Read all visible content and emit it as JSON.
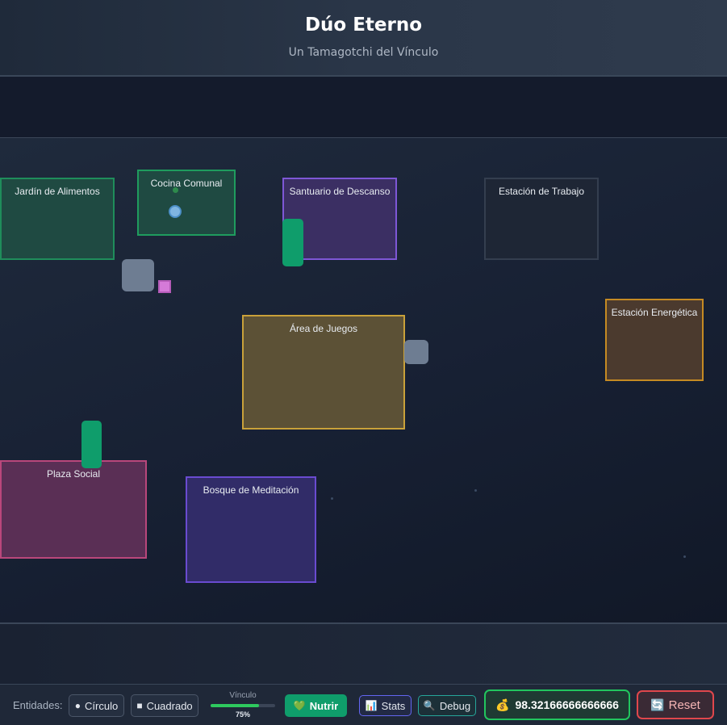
{
  "header": {
    "title": "Dúo Eterno",
    "subtitle": "Un Tamagotchi del Vínculo"
  },
  "zones": {
    "jardin": "Jardín de Alimentos",
    "cocina": "Cocina Comunal",
    "santuario": "Santuario de Descanso",
    "trabajo": "Estación de Trabajo",
    "energia": "Estación Energética",
    "juegos": "Área de Juegos",
    "plaza": "Plaza Social",
    "bosque": "Bosque de Meditación"
  },
  "toolbar": {
    "entities_label": "Entidades:",
    "circulo_label": "Círculo",
    "cuadrado_label": "Cuadrado",
    "vinculo_label": "Vínculo",
    "vinculo_value": 0.75,
    "vinculo_pct": "75%",
    "nutrir_label": "Nutrir",
    "stats_label": "Stats",
    "debug_label": "Debug",
    "coins_value": "98.32166666666666",
    "reset_label": "Reset"
  },
  "icons": {
    "circulo": "circle-icon",
    "cuadrado": "square-icon",
    "nutrir": "heart-icon",
    "stats": "bar-chart-icon",
    "debug": "magnifier-icon",
    "coins": "money-bag-icon",
    "reset": "refresh-icon"
  },
  "colors": {
    "accent_green": "#22c55e",
    "nutrir_bg": "#0f9d6b",
    "reset_border": "#e0474c",
    "stats_border": "#6366f1",
    "debug_border": "#26a69a"
  }
}
